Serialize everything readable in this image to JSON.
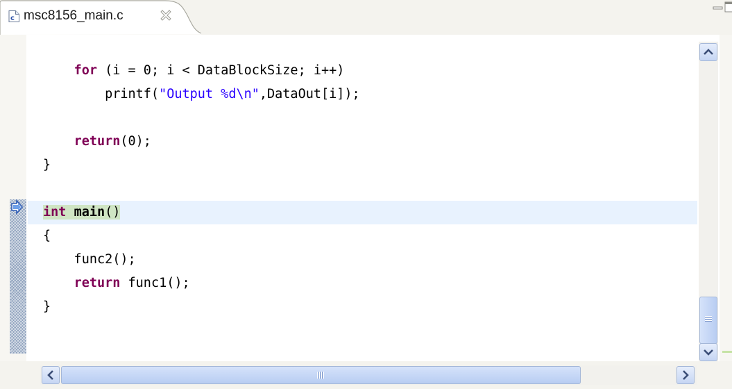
{
  "tab": {
    "filename": "msc8156_main.c",
    "file_icon": "c-source-file-icon",
    "close_icon": "close-icon"
  },
  "window_controls": [
    "minimize-icon",
    "maximize-icon"
  ],
  "code_lines": [
    {
      "tokens": []
    },
    {
      "tokens": [
        {
          "t": "    "
        },
        {
          "t": "for",
          "c": "kw"
        },
        {
          "t": " (i = 0; i < DataBlockSize; i++)"
        }
      ]
    },
    {
      "tokens": [
        {
          "t": "        printf("
        },
        {
          "t": "\"Output %d\\n\"",
          "c": "str"
        },
        {
          "t": ",DataOut[i]);"
        }
      ]
    },
    {
      "tokens": []
    },
    {
      "tokens": [
        {
          "t": "    "
        },
        {
          "t": "return",
          "c": "kw"
        },
        {
          "t": "(0);"
        }
      ]
    },
    {
      "tokens": [
        {
          "t": "}"
        }
      ]
    },
    {
      "tokens": []
    },
    {
      "current": true,
      "tokens": [
        {
          "t": "int",
          "c": "kw hl"
        },
        {
          "t": " ",
          "c": "hl"
        },
        {
          "t": "main",
          "c": "fn-bold hl"
        },
        {
          "t": "()",
          "c": "hl"
        }
      ]
    },
    {
      "tokens": [
        {
          "t": "{"
        }
      ]
    },
    {
      "tokens": [
        {
          "t": "    func2();"
        }
      ]
    },
    {
      "tokens": [
        {
          "t": "    "
        },
        {
          "t": "return",
          "c": "kw"
        },
        {
          "t": " func1();"
        }
      ]
    },
    {
      "tokens": [
        {
          "t": "}"
        }
      ]
    },
    {
      "tokens": []
    }
  ],
  "current_line_icon": "instruction-pointer-arrow-icon",
  "colors": {
    "keyword": "#7f0055",
    "string": "#2a00ff",
    "current_line": "#e8f2fe",
    "selection": "#cfe5c4"
  }
}
